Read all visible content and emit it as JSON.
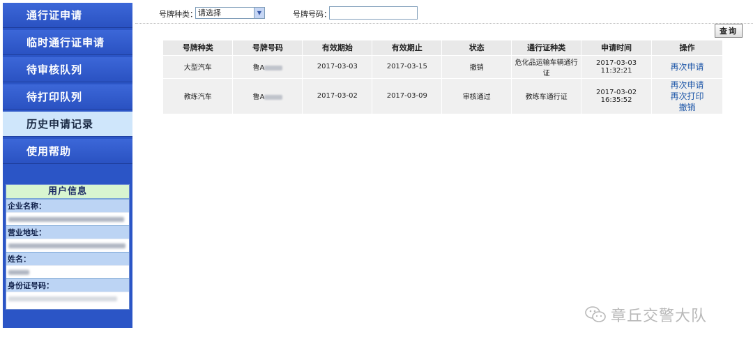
{
  "sidebar": {
    "nav": [
      {
        "label": "通行证申请"
      },
      {
        "label": "临时通行证申请"
      },
      {
        "label": "待审核队列"
      },
      {
        "label": "待打印队列"
      },
      {
        "label": "历史申请记录"
      },
      {
        "label": "使用帮助"
      }
    ],
    "active_index": 4,
    "user_info": {
      "title": "用户信息",
      "company_label": "企业名称：",
      "address_label": "营业地址：",
      "name_label": "姓名：",
      "id_label": "身份证号码："
    }
  },
  "search": {
    "plate_type_label": "号牌种类：",
    "plate_type_value": "请选择",
    "plate_no_label": "号牌号码：",
    "plate_no_value": "",
    "query_label": "查询"
  },
  "table": {
    "headers": [
      "号牌种类",
      "号牌号码",
      "有效期始",
      "有效期止",
      "状态",
      "通行证种类",
      "申请时间",
      "操作"
    ],
    "rows": [
      {
        "plate_type": "大型汽车",
        "plate_prefix": "鲁A",
        "start": "2017-03-03",
        "end": "2017-03-15",
        "status": "撤销",
        "permit_type": "危化品运输车辆通行证",
        "apply_date": "2017-03-03",
        "apply_time": "11:32:21",
        "actions": [
          "再次申请"
        ]
      },
      {
        "plate_type": "教练汽车",
        "plate_prefix": "鲁A",
        "start": "2017-03-02",
        "end": "2017-03-09",
        "status": "审核通过",
        "permit_type": "教练车通行证",
        "apply_date": "2017-03-02",
        "apply_time": "16:35:52",
        "actions": [
          "再次申请",
          "再次打印",
          "撤销"
        ]
      }
    ]
  },
  "watermark": {
    "text": "章丘交警大队",
    "icon": "wechat-icon"
  },
  "colors": {
    "sidebar": "#2b55c6",
    "active_nav": "#cfe6fb",
    "link": "#1d56a8",
    "table_bg": "#f0f0f0"
  }
}
